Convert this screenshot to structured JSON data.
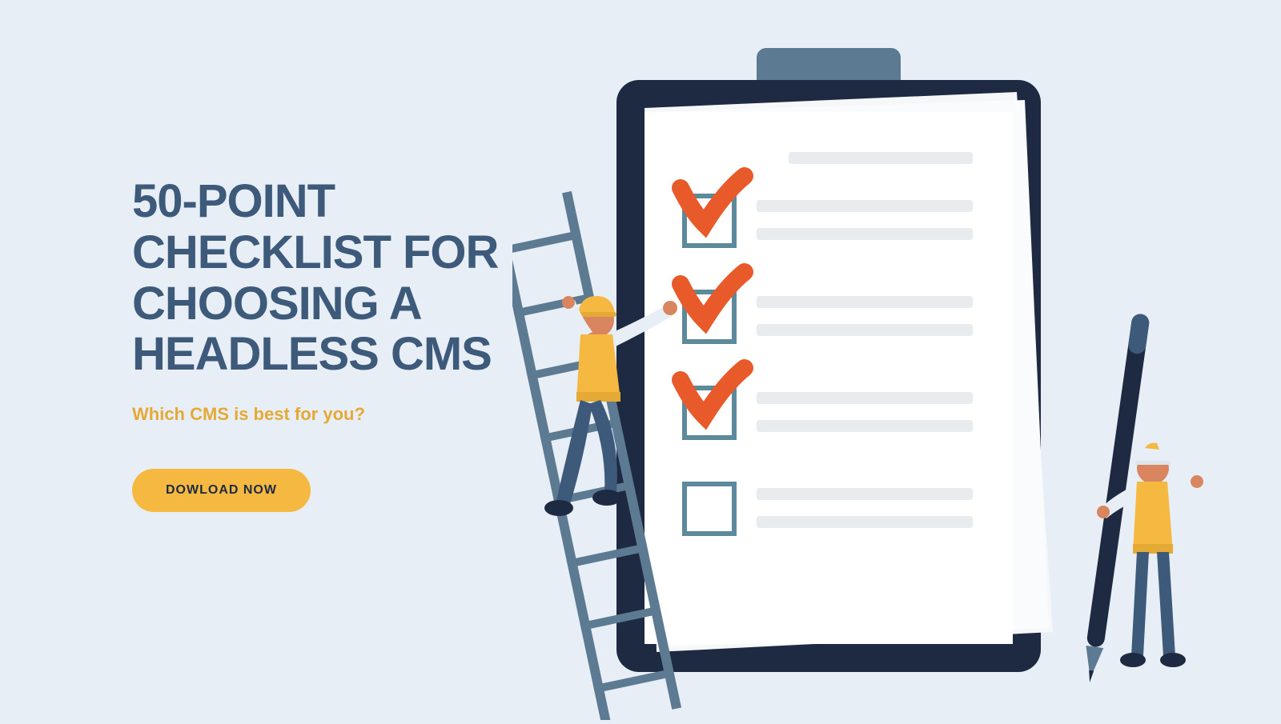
{
  "hero": {
    "title": "50-POINT CHECKLIST FOR CHOOSING A HEADLESS CMS",
    "subtitle": "Which CMS is best for you?",
    "cta_label": "DOWLOAD NOW"
  },
  "colors": {
    "background": "#e8eef5",
    "title": "#3e5a7a",
    "accent": "#f5b942",
    "subtitle": "#e5a935",
    "clipboard_dark": "#1e2942",
    "clipboard_clip": "#5c7a91",
    "paper": "#ffffff",
    "checkbox_border": "#5c8a9c",
    "checkmark": "#e85a2a",
    "line": "#e8ecef",
    "worker_skin": "#d88560",
    "worker_shirt": "#f5b942",
    "worker_pants": "#3e5a7a",
    "worker_sleeve": "#e8eef5",
    "ladder": "#5c7a91"
  },
  "illustration": {
    "checklist_items": [
      {
        "checked": true
      },
      {
        "checked": true
      },
      {
        "checked": true
      },
      {
        "checked": false
      }
    ]
  }
}
